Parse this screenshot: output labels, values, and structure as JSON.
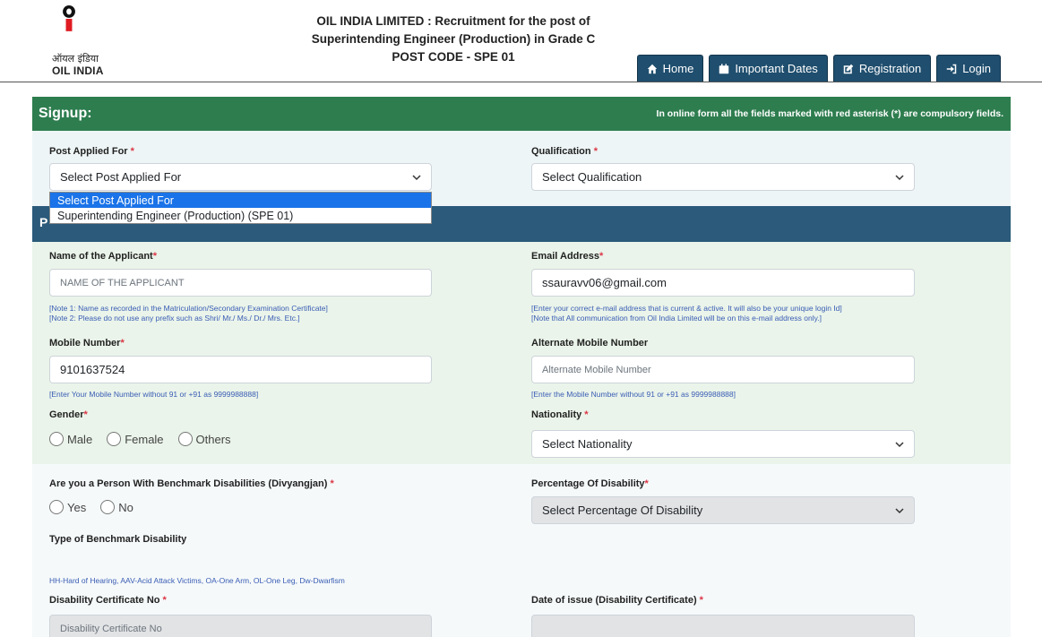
{
  "header": {
    "logo_hindi": "ऑयल इंडिया",
    "logo_english": "OIL INDIA",
    "title_line1": "OIL INDIA LIMITED : Recruitment for the post of",
    "title_line2": "Superintending Engineer (Production) in Grade C",
    "post_code_label": "POST CODE",
    "post_code_value": "- SPE 01",
    "nav": [
      {
        "label": "Home",
        "icon": "home-icon"
      },
      {
        "label": "Important Dates",
        "icon": "calendar-icon"
      },
      {
        "label": "Registration",
        "icon": "edit-icon"
      },
      {
        "label": "Login",
        "icon": "login-icon"
      }
    ]
  },
  "signup": {
    "title": "Signup:",
    "note": "In online form all the fields marked with red asterisk (*) are compulsory fields."
  },
  "post_applied": {
    "label": "Post Applied For",
    "value": "Select Post Applied For",
    "options": [
      "Select Post Applied For",
      "Superintending Engineer (Production) (SPE 01)"
    ]
  },
  "qualification": {
    "label": "Qualification",
    "value": "Select Qualification"
  },
  "section_letter": "P",
  "applicant_name": {
    "label": "Name of the Applicant",
    "placeholder": "NAME OF THE APPLICANT",
    "note1": "[Note 1: Name as recorded in the Matriculation/Secondary Examination Certificate]",
    "note2": "[Note 2: Please do not use any prefix such as Shri/ Mr./ Ms./ Dr./ Mrs. Etc.]"
  },
  "email": {
    "label": "Email Address",
    "value": "ssauravv06@gmail.com",
    "note1": "[Enter your correct e-mail address that is current & active. It will also be your unique login Id]",
    "note2": "[Note that All communication from Oil India Limited will be on this e-mail address only.]"
  },
  "mobile": {
    "label": "Mobile Number",
    "value": "9101637524",
    "note": "[Enter Your Mobile Number without 91 or +91 as 9999988888]"
  },
  "alt_mobile": {
    "label": "Alternate Mobile Number",
    "placeholder": "Alternate Mobile Number",
    "note": "[Enter the Mobile Number without 91 or +91 as 9999988888]"
  },
  "gender": {
    "label": "Gender",
    "options": [
      "Male",
      "Female",
      "Others"
    ]
  },
  "nationality": {
    "label": "Nationality",
    "value": "Select Nationality"
  },
  "pwbd": {
    "label": "Are you a Person With Benchmark Disabilities (Divyangjan)",
    "options": [
      "Yes",
      "No"
    ]
  },
  "disability_pct": {
    "label": "Percentage Of Disability",
    "value": "Select Percentage Of Disability"
  },
  "disability_type": {
    "label": "Type of Benchmark Disability",
    "note": "HH-Hard of Hearing, AAV-Acid Attack Victims, OA-One Arm, OL-One Leg, Dw-Dwarfism"
  },
  "disability_cert": {
    "label": "Disability Certificate No",
    "placeholder": "Disability Certificate No"
  },
  "disability_date": {
    "label": "Date of issue (Disability Certificate)"
  },
  "required_mark": "*"
}
